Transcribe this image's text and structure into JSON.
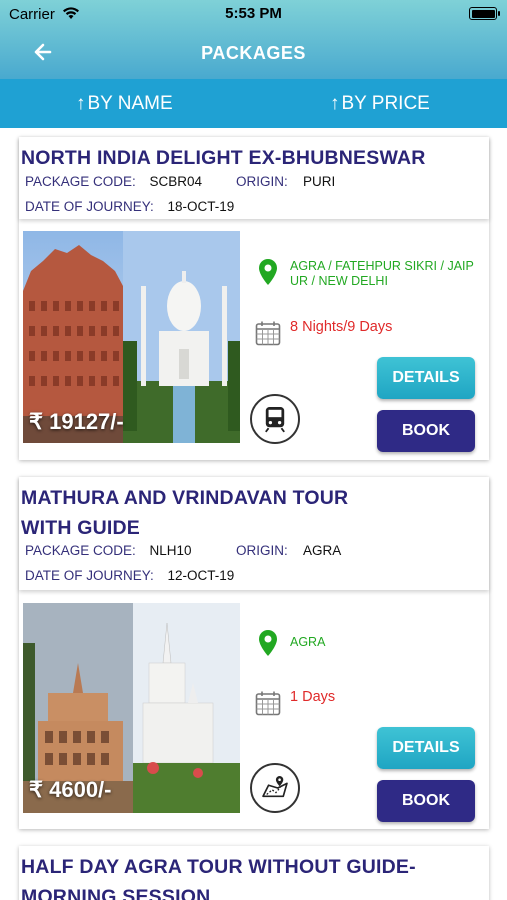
{
  "status_bar": {
    "carrier": "Carrier",
    "time": "5:53 PM",
    "battery_level": 1.0
  },
  "nav": {
    "title": "PACKAGES",
    "back_icon": "arrow-left-icon"
  },
  "sort": {
    "by_name": "BY NAME",
    "by_price": "BY PRICE",
    "arrow_icon": "arrow-up-icon"
  },
  "labels": {
    "package_code": "PACKAGE CODE:",
    "origin": "ORIGIN:",
    "date_of_journey": "DATE OF JOURNEY:",
    "details": "DETAILS",
    "book": "BOOK"
  },
  "packages": [
    {
      "title": "NORTH INDIA DELIGHT EX-BHUBNESWAR",
      "package_code": "SCBR04",
      "origin": "PURI",
      "date_of_journey": "18-OCT-19",
      "price": "₹ 19127/-",
      "destinations": "AGRA / FATEHPUR SIKRI / JAIPUR / NEW DELHI",
      "duration": "8 Nights/9 Days",
      "transport_icon": "train-icon"
    },
    {
      "title": "MATHURA AND VRINDAVAN TOUR WITH GUIDE",
      "package_code": "NLH10",
      "origin": "AGRA",
      "date_of_journey": "12-OCT-19",
      "price": "₹ 4600/-",
      "destinations": "AGRA",
      "duration": "1 Days",
      "transport_icon": "map-route-icon"
    },
    {
      "title": "HALF DAY AGRA TOUR WITHOUT GUIDE-MORNING SESSION"
    }
  ],
  "colors": {
    "title": "#2b2577",
    "location": "#22a822",
    "duration": "#e02a2a",
    "details_button": "#1fa5c3",
    "book_button": "#2f2a86",
    "sort_bar": "#1fa1d3"
  }
}
